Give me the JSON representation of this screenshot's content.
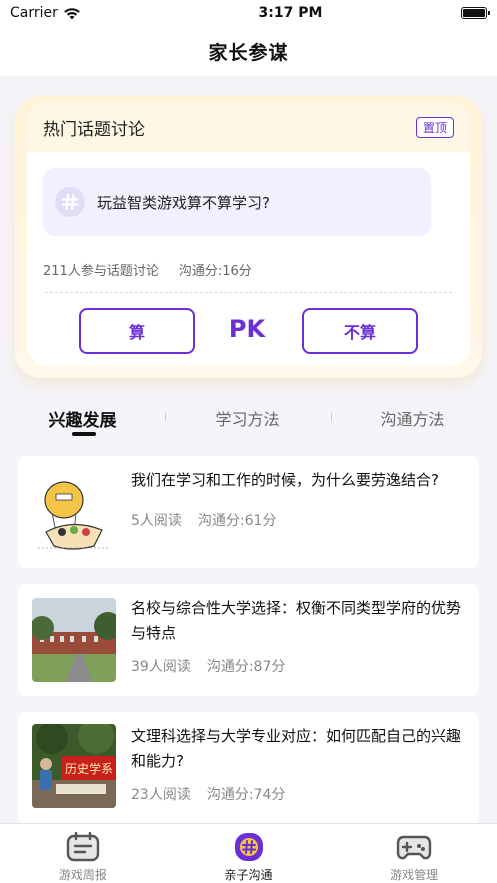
{
  "status": {
    "carrier": "Carrier",
    "time": "3:17 PM"
  },
  "nav": {
    "title": "家长参谋"
  },
  "topic": {
    "header": "热门话题讨论",
    "pin_label": "置顶",
    "question": "玩益智类游戏算不算学习?",
    "participants": "211人参与话题讨论",
    "score": "沟通分:16分",
    "yes_label": "算",
    "pk_label": "PK",
    "no_label": "不算",
    "accent_color": "#6a2fd6"
  },
  "tabs": [
    {
      "label": "兴趣发展",
      "active": true
    },
    {
      "label": "学习方法",
      "active": false
    },
    {
      "label": "沟通方法",
      "active": false
    }
  ],
  "articles": [
    {
      "title": "我们在学习和工作的时候，为什么要劳逸结合?",
      "reads": "5人阅读",
      "score": "沟通分:61分",
      "thumb": "balloon-cartoon"
    },
    {
      "title": "名校与综合性大学选择：权衡不同类型学府的优势与特点",
      "reads": "39人阅读",
      "score": "沟通分:87分",
      "thumb": "campus-photo"
    },
    {
      "title": "文理科选择与大学专业对应：如何匹配自己的兴趣和能力?",
      "reads": "23人阅读",
      "score": "沟通分:74分",
      "thumb": "booth-photo",
      "banner_text": "历史学系"
    }
  ],
  "tabbar": [
    {
      "label": "游戏周报",
      "icon": "calendar-icon",
      "active": false
    },
    {
      "label": "亲子沟通",
      "icon": "hash-chat-icon",
      "active": true
    },
    {
      "label": "游戏管理",
      "icon": "gamepad-icon",
      "active": false
    }
  ]
}
